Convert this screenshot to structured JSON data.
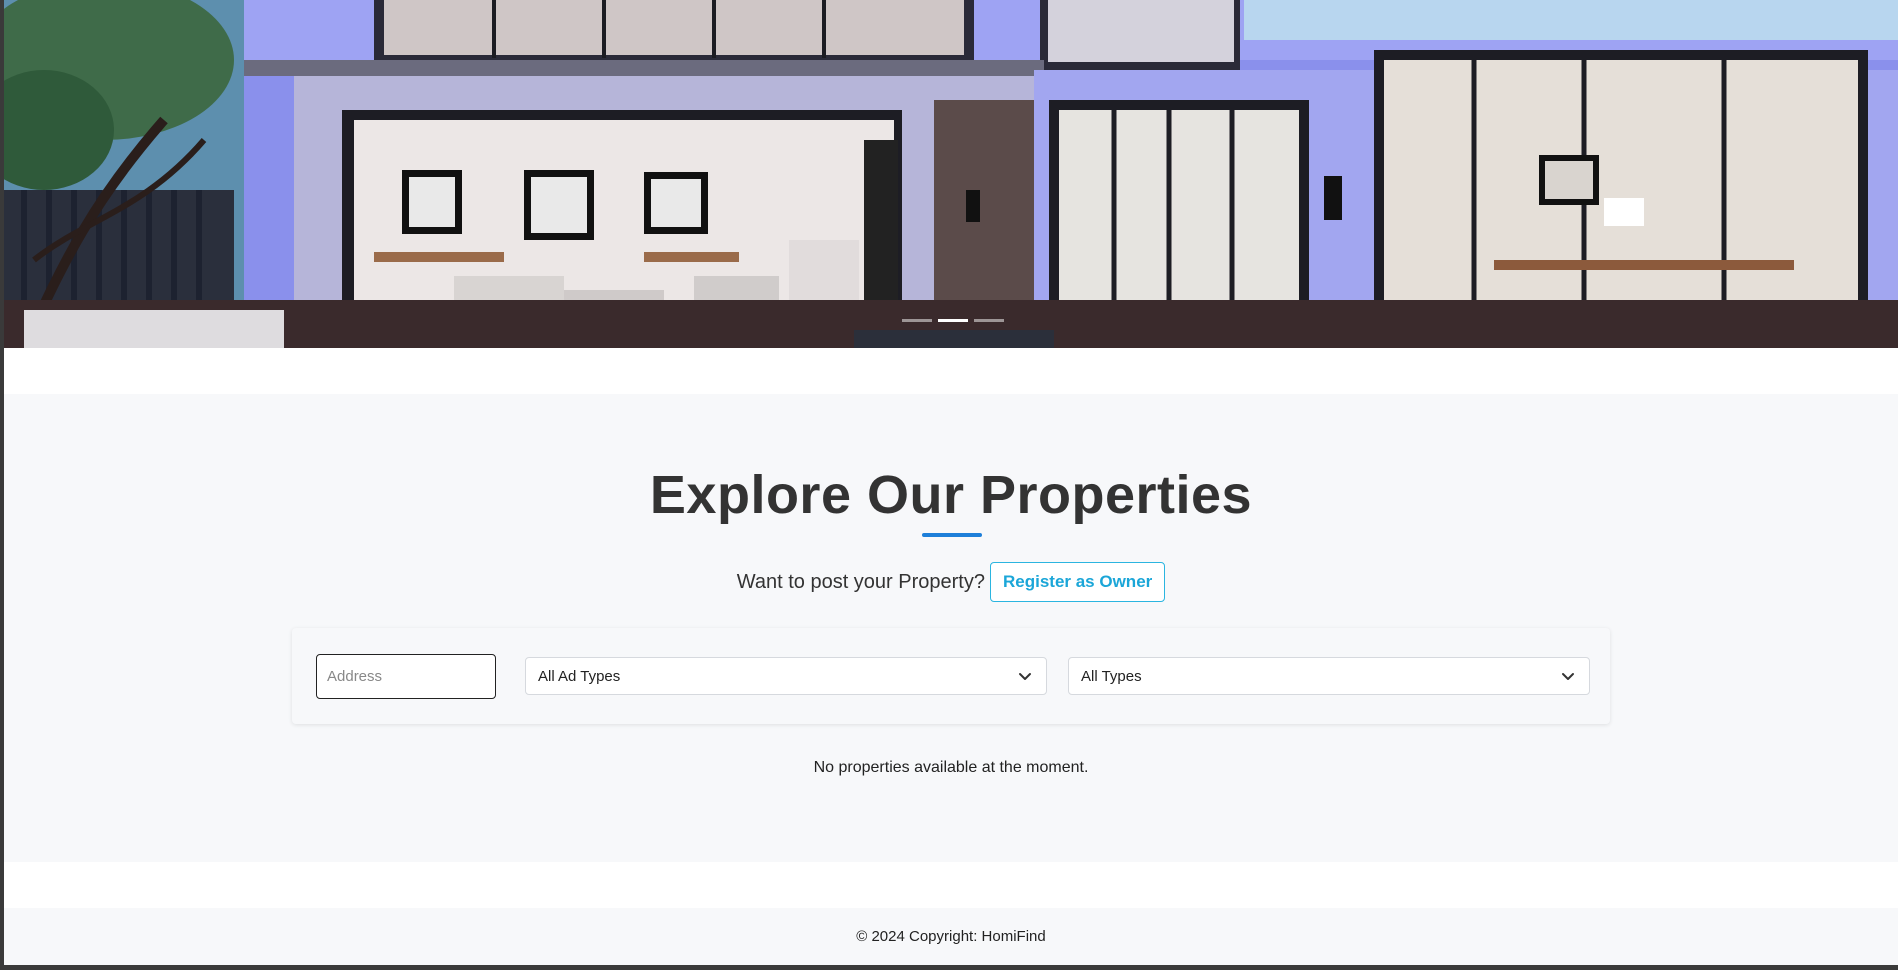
{
  "hero": {
    "carousel_indicators": [
      {
        "state": "inactive"
      },
      {
        "state": "active"
      },
      {
        "state": "inactive"
      }
    ]
  },
  "main": {
    "title": "Explore Our Properties",
    "cta_text": "Want to post your Property?",
    "register_button": "Register as Owner",
    "filters": {
      "address_placeholder": "Address",
      "ad_type_selected": "All Ad Types",
      "type_selected": "All Types"
    },
    "empty_message": "No properties available at the moment."
  },
  "footer": {
    "copyright": "© 2024 Copyright: HomiFind"
  },
  "colors": {
    "accent_underline": "#1e7fd9",
    "owner_button": "#1ba6d8",
    "section_bg": "#f7f8fa"
  },
  "icons": {
    "select_arrow": "chevron-down-icon"
  }
}
